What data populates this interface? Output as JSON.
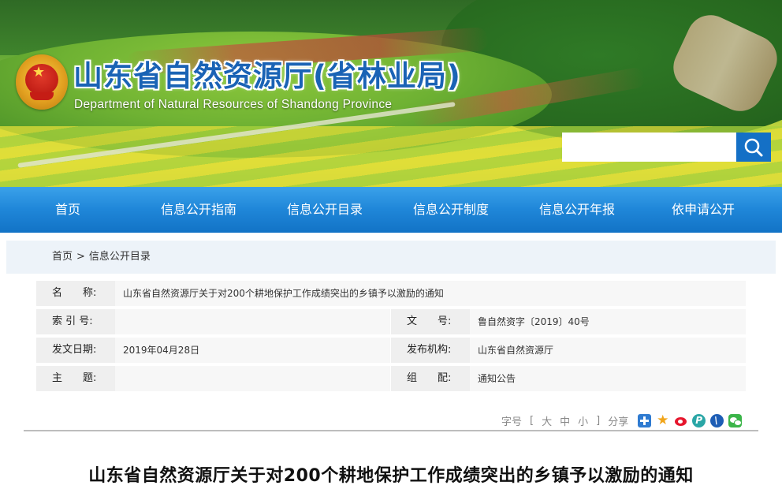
{
  "header": {
    "title": "山东省自然资源厅(省林业局)",
    "subtitle": "Department of Natural Resources of Shandong Province",
    "search": {
      "value": "",
      "placeholder": ""
    }
  },
  "nav": {
    "items": [
      {
        "label": "首页"
      },
      {
        "label": "信息公开指南"
      },
      {
        "label": "信息公开目录"
      },
      {
        "label": "信息公开制度"
      },
      {
        "label": "信息公开年报"
      },
      {
        "label": "依申请公开"
      }
    ]
  },
  "breadcrumb": {
    "home": "首页",
    "separator": ">",
    "current": "信息公开目录"
  },
  "meta": {
    "name_label": "名　　称:",
    "name_value": "山东省自然资源厅关于对200个耕地保护工作成绩突出的乡镇予以激励的通知",
    "index_label": "索 引 号:",
    "index_value": "",
    "doc_no_label": "文　　号:",
    "doc_no_value": "鲁自然资字〔2019〕40号",
    "date_label": "发文日期:",
    "date_value": "2019年04月28日",
    "publisher_label": "发布机构:",
    "publisher_value": "山东省自然资源厅",
    "subject_label": "主　　题:",
    "subject_value": "",
    "category_label": "组　　配:",
    "category_value": "通知公告"
  },
  "tools": {
    "font_size_label": "字号",
    "bracket_open": "[",
    "large": "大",
    "medium": "中",
    "small": "小",
    "bracket_close": "]",
    "share_label": "分享",
    "share_icons": [
      "plus-share-icon",
      "qzone-icon",
      "weibo-icon",
      "tencent-weibo-icon",
      "renren-icon",
      "wechat-icon"
    ]
  },
  "article": {
    "title": "山东省自然资源厅关于对200个耕地保护工作成绩突出的乡镇予以激励的通知"
  },
  "colors": {
    "nav_blue": "#1f86d8",
    "title_blue": "#1a63b5",
    "search_button": "#1470c6"
  }
}
